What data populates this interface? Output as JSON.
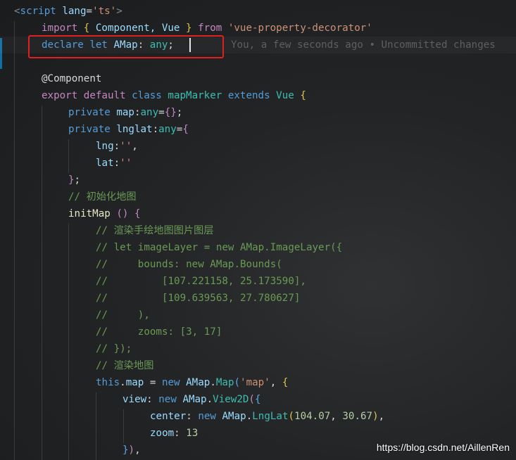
{
  "lines": [
    {
      "tokens": [
        [
          "<",
          "t-tag"
        ],
        [
          "script",
          "t-blue"
        ],
        [
          " ",
          "t-plain"
        ],
        [
          "lang",
          "t-var"
        ],
        [
          "=",
          "t-plain"
        ],
        [
          "'ts'",
          "t-str"
        ],
        [
          ">",
          "t-tag"
        ]
      ]
    },
    {
      "tokens": [
        [
          "import",
          "t-kw"
        ],
        [
          " ",
          "t-plain"
        ],
        [
          "{",
          "t-brk"
        ],
        [
          " Component, Vue ",
          "t-var"
        ],
        [
          "}",
          "t-brk"
        ],
        [
          " ",
          "t-plain"
        ],
        [
          "from",
          "t-kw"
        ],
        [
          " ",
          "t-plain"
        ],
        [
          "'vue-property-decorator'",
          "t-str"
        ]
      ]
    },
    {
      "tokens": [
        [
          "declare",
          "t-blue"
        ],
        [
          " ",
          "t-plain"
        ],
        [
          "let",
          "t-blue"
        ],
        [
          " ",
          "t-plain"
        ],
        [
          "AMap",
          "t-var"
        ],
        [
          ": ",
          "t-plain"
        ],
        [
          "any",
          "t-cls"
        ],
        [
          ";",
          "t-plain"
        ]
      ]
    },
    {
      "tokens": []
    },
    {
      "tokens": [
        [
          "@Component",
          "t-deco"
        ]
      ]
    },
    {
      "tokens": [
        [
          "export",
          "t-kw"
        ],
        [
          " ",
          "t-plain"
        ],
        [
          "default",
          "t-kw"
        ],
        [
          " ",
          "t-plain"
        ],
        [
          "class",
          "t-blue"
        ],
        [
          " ",
          "t-plain"
        ],
        [
          "mapMarker",
          "t-cls"
        ],
        [
          " ",
          "t-plain"
        ],
        [
          "extends",
          "t-blue"
        ],
        [
          " ",
          "t-plain"
        ],
        [
          "Vue",
          "t-cls"
        ],
        [
          " ",
          "t-plain"
        ],
        [
          "{",
          "t-brk"
        ]
      ]
    },
    {
      "tokens": [
        [
          "private",
          "t-blue"
        ],
        [
          " ",
          "t-plain"
        ],
        [
          "map",
          "t-var"
        ],
        [
          ":",
          "t-plain"
        ],
        [
          "any",
          "t-cls"
        ],
        [
          "=",
          "t-plain"
        ],
        [
          "{}",
          "t-brk2"
        ],
        [
          ";",
          "t-plain"
        ]
      ]
    },
    {
      "tokens": [
        [
          "private",
          "t-blue"
        ],
        [
          " ",
          "t-plain"
        ],
        [
          "lnglat",
          "t-var"
        ],
        [
          ":",
          "t-plain"
        ],
        [
          "any",
          "t-cls"
        ],
        [
          "=",
          "t-plain"
        ],
        [
          "{",
          "t-brk2"
        ]
      ]
    },
    {
      "tokens": [
        [
          "lng",
          "t-prop"
        ],
        [
          ":",
          "t-plain"
        ],
        [
          "''",
          "t-str"
        ],
        [
          ",",
          "t-plain"
        ]
      ]
    },
    {
      "tokens": [
        [
          "lat",
          "t-prop"
        ],
        [
          ":",
          "t-plain"
        ],
        [
          "''",
          "t-str"
        ]
      ]
    },
    {
      "tokens": [
        [
          "}",
          "t-brk2"
        ],
        [
          ";",
          "t-plain"
        ]
      ]
    },
    {
      "tokens": [
        [
          "// 初始化地图",
          "t-cmt"
        ]
      ]
    },
    {
      "tokens": [
        [
          "initMap",
          "t-fn"
        ],
        [
          " ",
          "t-plain"
        ],
        [
          "()",
          "t-brk2"
        ],
        [
          " ",
          "t-plain"
        ],
        [
          "{",
          "t-brk2"
        ]
      ]
    },
    {
      "tokens": [
        [
          "// 渲染手绘地图图片图层",
          "t-cmt"
        ]
      ]
    },
    {
      "tokens": [
        [
          "// let imageLayer = new AMap.ImageLayer({",
          "t-cmt"
        ]
      ]
    },
    {
      "tokens": [
        [
          "//     bounds: new AMap.Bounds(",
          "t-cmt"
        ]
      ]
    },
    {
      "tokens": [
        [
          "//         [107.221158, 25.173590],",
          "t-cmt"
        ]
      ]
    },
    {
      "tokens": [
        [
          "//         [109.639563, 27.780627]",
          "t-cmt"
        ]
      ]
    },
    {
      "tokens": [
        [
          "//     ),",
          "t-cmt"
        ]
      ]
    },
    {
      "tokens": [
        [
          "//     zooms: [3, 17]",
          "t-cmt"
        ]
      ]
    },
    {
      "tokens": [
        [
          "// });",
          "t-cmt"
        ]
      ]
    },
    {
      "tokens": [
        [
          "// 渲染地图",
          "t-cmt"
        ]
      ]
    },
    {
      "tokens": [
        [
          "this",
          "t-blue"
        ],
        [
          ".",
          "t-plain"
        ],
        [
          "map",
          "t-var"
        ],
        [
          " = ",
          "t-plain"
        ],
        [
          "new",
          "t-blue"
        ],
        [
          " ",
          "t-plain"
        ],
        [
          "AMap",
          "t-var"
        ],
        [
          ".",
          "t-plain"
        ],
        [
          "Map",
          "t-cls"
        ],
        [
          "(",
          "t-brk3"
        ],
        [
          "'map'",
          "t-str"
        ],
        [
          ", ",
          "t-plain"
        ],
        [
          "{",
          "t-brk"
        ]
      ]
    },
    {
      "tokens": [
        [
          "view",
          "t-prop"
        ],
        [
          ": ",
          "t-plain"
        ],
        [
          "new",
          "t-blue"
        ],
        [
          " ",
          "t-plain"
        ],
        [
          "AMap",
          "t-var"
        ],
        [
          ".",
          "t-plain"
        ],
        [
          "View2D",
          "t-cls"
        ],
        [
          "(",
          "t-brk2"
        ],
        [
          "{",
          "t-brk3"
        ]
      ]
    },
    {
      "tokens": [
        [
          "center",
          "t-prop"
        ],
        [
          ": ",
          "t-plain"
        ],
        [
          "new",
          "t-blue"
        ],
        [
          " ",
          "t-plain"
        ],
        [
          "AMap",
          "t-var"
        ],
        [
          ".",
          "t-plain"
        ],
        [
          "LngLat",
          "t-cls"
        ],
        [
          "(",
          "t-brk"
        ],
        [
          "104.07",
          "t-num"
        ],
        [
          ", ",
          "t-plain"
        ],
        [
          "30.67",
          "t-num"
        ],
        [
          ")",
          "t-brk"
        ],
        [
          ",",
          "t-plain"
        ]
      ]
    },
    {
      "tokens": [
        [
          "zoom",
          "t-prop"
        ],
        [
          ": ",
          "t-plain"
        ],
        [
          "13",
          "t-num"
        ]
      ]
    },
    {
      "tokens": [
        [
          "}",
          "t-brk3"
        ],
        [
          ")",
          "t-brk2"
        ],
        [
          ",",
          "t-plain"
        ]
      ]
    }
  ],
  "blame": "You, a few seconds ago • Uncommitted changes",
  "watermark": "https://blog.csdn.net/AillenRen"
}
